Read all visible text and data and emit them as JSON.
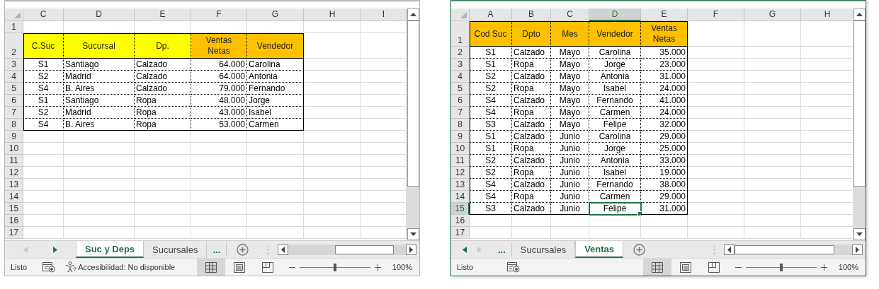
{
  "windows": [
    {
      "active": false,
      "columns": [
        {
          "label": "C",
          "selected": false
        },
        {
          "label": "D",
          "selected": false
        },
        {
          "label": "E",
          "selected": false
        },
        {
          "label": "F",
          "selected": false
        },
        {
          "label": "G",
          "selected": false
        },
        {
          "label": "H",
          "selected": false
        },
        {
          "label": "I",
          "selected": false
        }
      ],
      "rows": [
        {
          "label": "1",
          "selected": false
        },
        {
          "label": "2",
          "selected": false,
          "cells": [
            {
              "text": "C.Suc",
              "kind": "header",
              "color": "#ffff00",
              "selected": false
            },
            {
              "text": "Sucursal",
              "kind": "header",
              "color": "#ffff00",
              "selected": false
            },
            {
              "text": "Dp.",
              "kind": "header",
              "color": "#ffff00",
              "selected": false
            },
            {
              "text": "Ventas Netas",
              "kind": "header",
              "color": "#ffc000",
              "selected": false
            },
            {
              "text": "Vendedor",
              "kind": "header",
              "color": "#ffc000",
              "selected": false
            }
          ]
        },
        {
          "label": "3",
          "selected": false,
          "cells": [
            {
              "text": "S1",
              "kind": "centered",
              "selected": false
            },
            {
              "text": "Santiago",
              "kind": "text",
              "selected": false
            },
            {
              "text": "Calzado",
              "kind": "text",
              "selected": false
            },
            {
              "text": "64.000",
              "kind": "number",
              "selected": false
            },
            {
              "text": "Carolina",
              "kind": "text",
              "selected": false
            }
          ]
        },
        {
          "label": "4",
          "selected": false,
          "cells": [
            {
              "text": "S2",
              "kind": "centered",
              "selected": false
            },
            {
              "text": "Madrid",
              "kind": "text",
              "selected": false
            },
            {
              "text": "Calzado",
              "kind": "text",
              "selected": false
            },
            {
              "text": "64.000",
              "kind": "number",
              "selected": false
            },
            {
              "text": "Antonia",
              "kind": "text",
              "selected": false
            }
          ]
        },
        {
          "label": "5",
          "selected": false,
          "cells": [
            {
              "text": "S4",
              "kind": "centered",
              "selected": false
            },
            {
              "text": "B. Aires",
              "kind": "text",
              "selected": false
            },
            {
              "text": "Calzado",
              "kind": "text",
              "selected": false
            },
            {
              "text": "79.000",
              "kind": "number",
              "selected": false
            },
            {
              "text": "Fernando",
              "kind": "text",
              "selected": false
            }
          ]
        },
        {
          "label": "6",
          "selected": false,
          "cells": [
            {
              "text": "S1",
              "kind": "centered",
              "selected": false
            },
            {
              "text": "Santiago",
              "kind": "text",
              "selected": false
            },
            {
              "text": "Ropa",
              "kind": "text",
              "selected": false
            },
            {
              "text": "48.000",
              "kind": "number",
              "selected": false
            },
            {
              "text": "Jorge",
              "kind": "text",
              "selected": false
            }
          ]
        },
        {
          "label": "7",
          "selected": false,
          "cells": [
            {
              "text": "S2",
              "kind": "centered",
              "selected": false
            },
            {
              "text": "Madrid",
              "kind": "text",
              "selected": false
            },
            {
              "text": "Ropa",
              "kind": "text",
              "selected": false
            },
            {
              "text": "43.000",
              "kind": "number",
              "selected": false
            },
            {
              "text": "Isabel",
              "kind": "text",
              "selected": false
            }
          ]
        },
        {
          "label": "8",
          "selected": false,
          "cells": [
            {
              "text": "S4",
              "kind": "centered",
              "selected": false
            },
            {
              "text": "B. Aires",
              "kind": "text",
              "selected": false
            },
            {
              "text": "Ropa",
              "kind": "text",
              "selected": false
            },
            {
              "text": "53.000",
              "kind": "number",
              "selected": false
            },
            {
              "text": "Carmen",
              "kind": "text",
              "selected": false
            }
          ]
        },
        {
          "label": "9",
          "selected": false
        },
        {
          "label": "10",
          "selected": false
        },
        {
          "label": "11",
          "selected": false
        },
        {
          "label": "12",
          "selected": false
        },
        {
          "label": "13",
          "selected": false
        },
        {
          "label": "14",
          "selected": false
        },
        {
          "label": "15",
          "selected": false
        },
        {
          "label": "16",
          "selected": false
        },
        {
          "label": "17",
          "selected": false
        }
      ],
      "nav": [
        {
          "kind": "prev",
          "disabled": true
        },
        {
          "kind": "next",
          "disabled": false
        }
      ],
      "tabs": [
        {
          "kind": "sheet",
          "label": "Suc y Deps",
          "selected": true
        },
        {
          "kind": "sheet",
          "label": "Sucursales",
          "selected": false
        },
        {
          "kind": "more",
          "label": "..."
        }
      ],
      "status": {
        "text": "Listo",
        "accessibility": "Accesibilidad: No disponible",
        "views": [
          {
            "kind": "normal",
            "selected": true
          },
          {
            "kind": "page-layout",
            "selected": false
          },
          {
            "kind": "page-break",
            "selected": false
          }
        ],
        "zoom": {
          "level": 0.5,
          "reading": "100%"
        }
      }
    },
    {
      "active": true,
      "columns": [
        {
          "label": "A",
          "selected": false
        },
        {
          "label": "B",
          "selected": false
        },
        {
          "label": "C",
          "selected": false
        },
        {
          "label": "D",
          "selected": true
        },
        {
          "label": "E",
          "selected": false
        },
        {
          "label": "F",
          "selected": false
        },
        {
          "label": "G",
          "selected": false
        },
        {
          "label": "H",
          "selected": false
        }
      ],
      "rows": [
        {
          "label": "1",
          "selected": false,
          "cells": [
            {
              "text": "Cod Suc",
              "kind": "header",
              "color": "#ffc000",
              "selected": false
            },
            {
              "text": "Dpto",
              "kind": "header",
              "color": "#ffc000",
              "selected": false
            },
            {
              "text": "Mes",
              "kind": "header",
              "color": "#ffc000",
              "selected": false
            },
            {
              "text": "Vendedor",
              "kind": "header",
              "color": "#ffc000",
              "selected": false
            },
            {
              "text": "Ventas Netas",
              "kind": "header",
              "color": "#ffc000",
              "selected": false
            }
          ]
        },
        {
          "label": "2",
          "selected": false,
          "cells": [
            {
              "text": "S1",
              "kind": "centered",
              "selected": false
            },
            {
              "text": "Calzado",
              "kind": "text",
              "selected": false
            },
            {
              "text": "Mayo",
              "kind": "centered",
              "selected": false
            },
            {
              "text": "Carolina",
              "kind": "centered",
              "selected": false
            },
            {
              "text": "35.000",
              "kind": "number",
              "selected": false
            }
          ]
        },
        {
          "label": "3",
          "selected": false,
          "cells": [
            {
              "text": "S1",
              "kind": "centered",
              "selected": false
            },
            {
              "text": "Ropa",
              "kind": "text",
              "selected": false
            },
            {
              "text": "Mayo",
              "kind": "centered",
              "selected": false
            },
            {
              "text": "Jorge",
              "kind": "centered",
              "selected": false
            },
            {
              "text": "23.000",
              "kind": "number",
              "selected": false
            }
          ]
        },
        {
          "label": "4",
          "selected": false,
          "cells": [
            {
              "text": "S2",
              "kind": "centered",
              "selected": false
            },
            {
              "text": "Calzado",
              "kind": "text",
              "selected": false
            },
            {
              "text": "Mayo",
              "kind": "centered",
              "selected": false
            },
            {
              "text": "Antonia",
              "kind": "centered",
              "selected": false
            },
            {
              "text": "31.000",
              "kind": "number",
              "selected": false
            }
          ]
        },
        {
          "label": "5",
          "selected": false,
          "cells": [
            {
              "text": "S2",
              "kind": "centered",
              "selected": false
            },
            {
              "text": "Ropa",
              "kind": "text",
              "selected": false
            },
            {
              "text": "Mayo",
              "kind": "centered",
              "selected": false
            },
            {
              "text": "Isabel",
              "kind": "centered",
              "selected": false
            },
            {
              "text": "24.000",
              "kind": "number",
              "selected": false
            }
          ]
        },
        {
          "label": "6",
          "selected": false,
          "cells": [
            {
              "text": "S4",
              "kind": "centered",
              "selected": false
            },
            {
              "text": "Calzado",
              "kind": "text",
              "selected": false
            },
            {
              "text": "Mayo",
              "kind": "centered",
              "selected": false
            },
            {
              "text": "Fernando",
              "kind": "centered",
              "selected": false
            },
            {
              "text": "41.000",
              "kind": "number",
              "selected": false
            }
          ]
        },
        {
          "label": "7",
          "selected": false,
          "cells": [
            {
              "text": "S4",
              "kind": "centered",
              "selected": false
            },
            {
              "text": "Ropa",
              "kind": "text",
              "selected": false
            },
            {
              "text": "Mayo",
              "kind": "centered",
              "selected": false
            },
            {
              "text": "Carmen",
              "kind": "centered",
              "selected": false
            },
            {
              "text": "24.000",
              "kind": "number",
              "selected": false
            }
          ]
        },
        {
          "label": "8",
          "selected": false,
          "cells": [
            {
              "text": "S3",
              "kind": "centered",
              "selected": false
            },
            {
              "text": "Calzado",
              "kind": "text",
              "selected": false
            },
            {
              "text": "Mayo",
              "kind": "centered",
              "selected": false
            },
            {
              "text": "Felipe",
              "kind": "centered",
              "selected": false
            },
            {
              "text": "32.000",
              "kind": "number",
              "selected": false
            }
          ]
        },
        {
          "label": "9",
          "selected": false,
          "cells": [
            {
              "text": "S1",
              "kind": "centered",
              "selected": false
            },
            {
              "text": "Calzado",
              "kind": "text",
              "selected": false
            },
            {
              "text": "Junio",
              "kind": "centered",
              "selected": false
            },
            {
              "text": "Carolina",
              "kind": "centered",
              "selected": false
            },
            {
              "text": "29.000",
              "kind": "number",
              "selected": false
            }
          ]
        },
        {
          "label": "10",
          "selected": false,
          "cells": [
            {
              "text": "S1",
              "kind": "centered",
              "selected": false
            },
            {
              "text": "Ropa",
              "kind": "text",
              "selected": false
            },
            {
              "text": "Junio",
              "kind": "centered",
              "selected": false
            },
            {
              "text": "Jorge",
              "kind": "centered",
              "selected": false
            },
            {
              "text": "25.000",
              "kind": "number",
              "selected": false
            }
          ]
        },
        {
          "label": "11",
          "selected": false,
          "cells": [
            {
              "text": "S2",
              "kind": "centered",
              "selected": false
            },
            {
              "text": "Calzado",
              "kind": "text",
              "selected": false
            },
            {
              "text": "Junio",
              "kind": "centered",
              "selected": false
            },
            {
              "text": "Antonia",
              "kind": "centered",
              "selected": false
            },
            {
              "text": "33.000",
              "kind": "number",
              "selected": false
            }
          ]
        },
        {
          "label": "12",
          "selected": false,
          "cells": [
            {
              "text": "S2",
              "kind": "centered",
              "selected": false
            },
            {
              "text": "Ropa",
              "kind": "text",
              "selected": false
            },
            {
              "text": "Junio",
              "kind": "centered",
              "selected": false
            },
            {
              "text": "Isabel",
              "kind": "centered",
              "selected": false
            },
            {
              "text": "19.000",
              "kind": "number",
              "selected": false
            }
          ]
        },
        {
          "label": "13",
          "selected": false,
          "cells": [
            {
              "text": "S4",
              "kind": "centered",
              "selected": false
            },
            {
              "text": "Calzado",
              "kind": "text",
              "selected": false
            },
            {
              "text": "Junio",
              "kind": "centered",
              "selected": false
            },
            {
              "text": "Fernando",
              "kind": "centered",
              "selected": false
            },
            {
              "text": "38.000",
              "kind": "number",
              "selected": false
            }
          ]
        },
        {
          "label": "14",
          "selected": false,
          "cells": [
            {
              "text": "S4",
              "kind": "centered",
              "selected": false
            },
            {
              "text": "Ropa",
              "kind": "text",
              "selected": false
            },
            {
              "text": "Junio",
              "kind": "centered",
              "selected": false
            },
            {
              "text": "Carmen",
              "kind": "centered",
              "selected": false
            },
            {
              "text": "29.000",
              "kind": "number",
              "selected": false
            }
          ]
        },
        {
          "label": "15",
          "selected": true,
          "cells": [
            {
              "text": "S3",
              "kind": "centered",
              "selected": false
            },
            {
              "text": "Calzado",
              "kind": "text",
              "selected": false
            },
            {
              "text": "Junio",
              "kind": "centered",
              "selected": false
            },
            {
              "text": "Felipe",
              "kind": "centered",
              "selected": true
            },
            {
              "text": "31.000",
              "kind": "number",
              "selected": false
            }
          ]
        },
        {
          "label": "16",
          "selected": false
        },
        {
          "label": "17",
          "selected": false
        }
      ],
      "nav": [
        {
          "kind": "prev",
          "disabled": false
        },
        {
          "kind": "next",
          "disabled": true
        }
      ],
      "tabs": [
        {
          "kind": "more",
          "label": "..."
        },
        {
          "kind": "sheet",
          "label": "Sucursales",
          "selected": false
        },
        {
          "kind": "sheet",
          "label": "Ventas",
          "selected": true
        }
      ],
      "status": {
        "text": "Listo",
        "views": [
          {
            "kind": "normal",
            "selected": true
          },
          {
            "kind": "page-layout",
            "selected": false
          },
          {
            "kind": "page-break",
            "selected": false
          }
        ],
        "zoom": {
          "level": 0.5,
          "reading": "100%"
        }
      }
    }
  ]
}
